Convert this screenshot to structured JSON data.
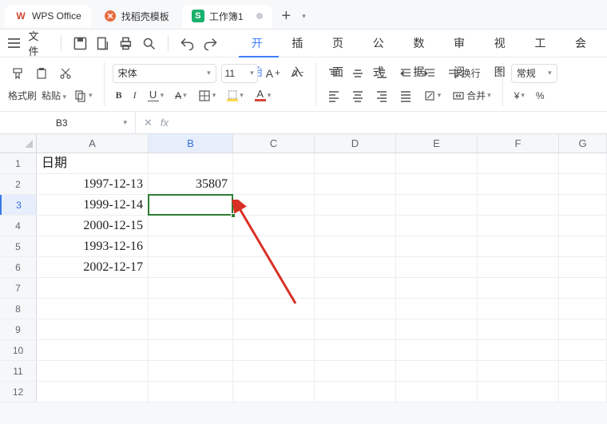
{
  "tabs": {
    "app_name": "WPS Office",
    "template_tab": "找稻壳模板",
    "workbook_tab": "工作簿1"
  },
  "quickbar": {
    "file_label": "文件"
  },
  "menutabs": {
    "start": "开始",
    "insert": "插入",
    "page": "页面",
    "formula": "公式",
    "data": "数据",
    "review": "审阅",
    "view": "视图",
    "tools": "工具",
    "more": "会"
  },
  "ribbon": {
    "format_brush": "格式刷",
    "paste": "粘贴",
    "font_name": "宋体",
    "font_size": "11",
    "wrap": "换行",
    "merge": "合并",
    "number_format": "常规",
    "currency": "¥",
    "percent": "%"
  },
  "fxbar": {
    "cell_ref": "B3",
    "fx_label": "fx"
  },
  "columns": [
    "A",
    "B",
    "C",
    "D",
    "E",
    "F",
    "G"
  ],
  "rows": [
    "1",
    "2",
    "3",
    "4",
    "5",
    "6",
    "7",
    "8",
    "9",
    "10",
    "11",
    "12"
  ],
  "cells": {
    "A1": "日期",
    "A2": "1997-12-13",
    "A3": "1999-12-14",
    "A4": "2000-12-15",
    "A5": "1993-12-16",
    "A6": "2002-12-17",
    "B2": "35807"
  },
  "selection": {
    "active": "B3"
  }
}
